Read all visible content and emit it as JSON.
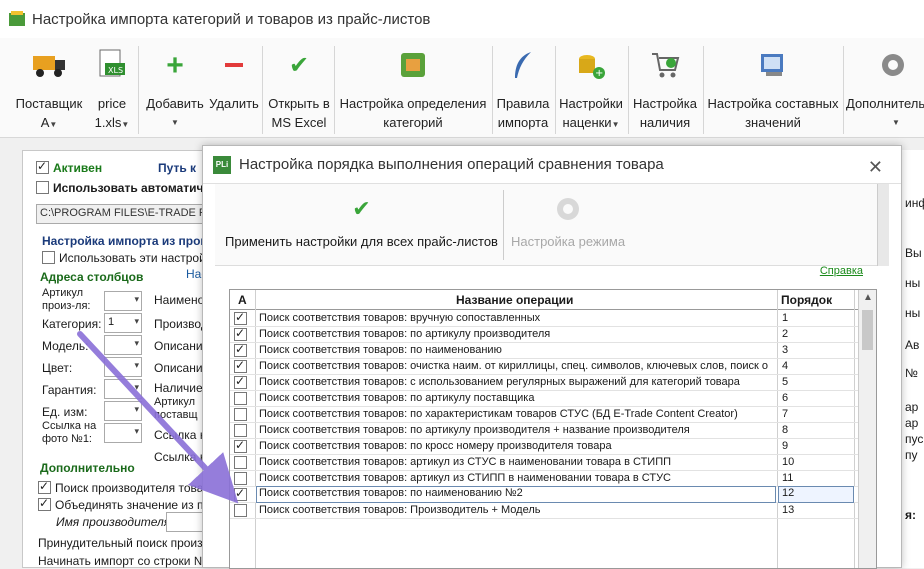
{
  "window": {
    "title": "Настройка импорта категорий и товаров из прайс-листов"
  },
  "ribbon": {
    "buttons": [
      {
        "line1": "Поставщик",
        "line2": "А",
        "has_caret": true,
        "icon": "truck-icon"
      },
      {
        "line1": "price",
        "line2": "1.xls",
        "has_caret": true,
        "icon": "xls-file-icon"
      },
      {
        "line1": "Добавить",
        "line2": "",
        "has_caret": true,
        "icon": "plus-icon"
      },
      {
        "line1": "Удалить",
        "line2": "",
        "has_caret": false,
        "icon": "minus-icon"
      },
      {
        "line1": "Открыть в",
        "line2": "MS Excel",
        "has_caret": false,
        "icon": "checkmark-icon"
      },
      {
        "line1": "Настройка определения",
        "line2": "категорий",
        "has_caret": false,
        "icon": "categories-icon"
      },
      {
        "line1": "Правила",
        "line2": "импорта",
        "has_caret": false,
        "icon": "feather-icon"
      },
      {
        "line1": "Настройки",
        "line2": "наценки",
        "has_caret": true,
        "icon": "coins-icon"
      },
      {
        "line1": "Настройка",
        "line2": "наличия",
        "has_caret": false,
        "icon": "cart-icon"
      },
      {
        "line1": "Настройка составных",
        "line2": "значений",
        "has_caret": false,
        "icon": "composite-icon"
      },
      {
        "line1": "Дополнитель",
        "line2": "",
        "has_caret": true,
        "icon": "gear-icon"
      }
    ]
  },
  "background": {
    "active_label": "Активен",
    "path_label": "Путь к",
    "use_auto_label": "Использовать автоматич",
    "path_value": "C:\\PROGRAM FILES\\E-TRADE PRI",
    "import_settings_label": "Настройка импорта из прог",
    "use_settings_label": "Использовать эти настройк",
    "columns_header": "Адреса столбцов",
    "columns_tab": "Нас",
    "fields": [
      {
        "label": "Артикул произ-ля:",
        "value": "",
        "right": "Наименов"
      },
      {
        "label": "Категория:",
        "value": "1",
        "right": "Производ"
      },
      {
        "label": "Модель:",
        "value": "",
        "right": "Описание"
      },
      {
        "label": "Цвет:",
        "value": "",
        "right": "Описание"
      },
      {
        "label": "Гарантия:",
        "value": "",
        "right": "Наличие"
      },
      {
        "label": "Ед. изм:",
        "value": "",
        "right": "Артикул поставщ"
      },
      {
        "label": "Ссылка на фото №1:",
        "value": "",
        "right": "Ссылка н"
      }
    ],
    "extra_right": "Ссылка н",
    "additional_header": "Дополнительно",
    "search_manufacturer": "Поиск производителя товар",
    "merge_values": "Объединять значение из пол",
    "manufacturer_name_label": "Имя производителя:",
    "forced_search": "Принудительный поиск произво",
    "start_import_row": "Начинать импорт со строки №:",
    "right_strip": [
      "инф",
      "Вы",
      "ны",
      "ны",
      "Ав",
      "т",
      "№",
      "ар",
      "ар",
      "пус",
      "пу",
      "я:"
    ]
  },
  "dialog": {
    "title": "Настройка порядка выполнения операций сравнения товара",
    "logo_text": "PLi",
    "apply_all_label": "Применить настройки для всех прайс-листов",
    "mode_settings_label": "Настройка режима",
    "help_link": "Справка",
    "columns": {
      "active": "А",
      "name": "Название операции",
      "order": "Порядок"
    },
    "rows": [
      {
        "checked": true,
        "name": "Поиск соответствия товаров: вручную сопоставленных",
        "order": "1"
      },
      {
        "checked": true,
        "name": "Поиск соответствия товаров: по артикулу производителя",
        "order": "2"
      },
      {
        "checked": true,
        "name": "Поиск соответствия товаров: по наименованию",
        "order": "3"
      },
      {
        "checked": true,
        "name": "Поиск соответствия товаров: очистка наим. от кириллицы, спец. символов, ключевых слов, поиск о",
        "order": "4"
      },
      {
        "checked": true,
        "name": "Поиск соответствия товаров: с использованием регулярных выражений для категорий товара",
        "order": "5"
      },
      {
        "checked": false,
        "name": "Поиск соответствия товаров: по артикулу поставщика",
        "order": "6"
      },
      {
        "checked": false,
        "name": "Поиск соответствия товаров: по характеристикам товаров СТУС (БД E-Trade Content Creator)",
        "order": "7"
      },
      {
        "checked": false,
        "name": "Поиск соответствия товаров: по артикулу производителя + название производителя",
        "order": "8"
      },
      {
        "checked": true,
        "name": "Поиск соответствия товаров: по кросс номеру производителя товара",
        "order": "9"
      },
      {
        "checked": false,
        "name": "Поиск соответствия товаров: артикул из СТУС в наименовании товара в СТИПП",
        "order": "10"
      },
      {
        "checked": false,
        "name": "Поиск соответствия товаров: артикул из СТИПП в наименовании товара в СТУС",
        "order": "11"
      },
      {
        "checked": true,
        "name": "Поиск соответствия товаров: по наименованию №2",
        "order": "12",
        "selected": true
      },
      {
        "checked": false,
        "name": "Поиск соответствия товаров: Производитель + Модель",
        "order": "13"
      }
    ]
  }
}
